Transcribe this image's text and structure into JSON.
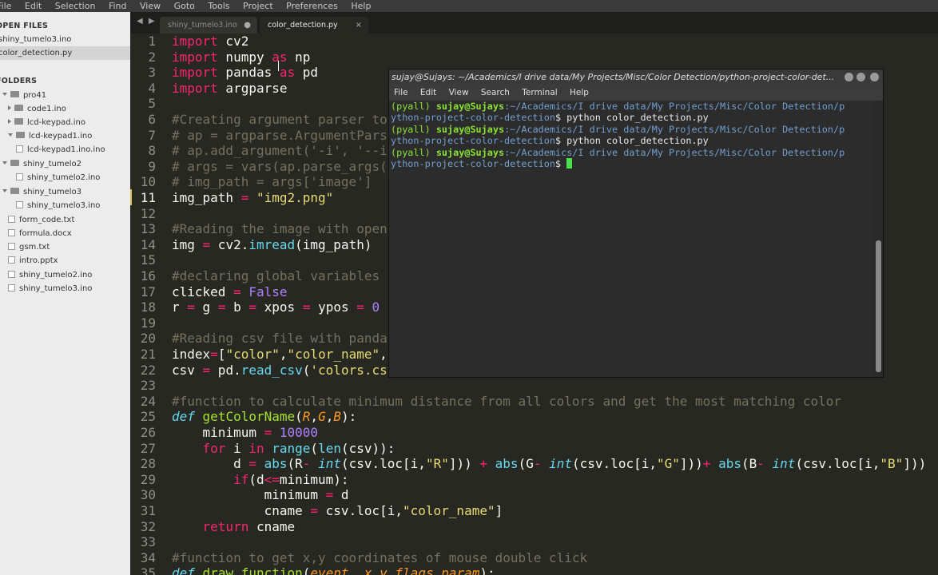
{
  "menubar": {
    "items": [
      "File",
      "Edit",
      "Selection",
      "Find",
      "View",
      "Goto",
      "Tools",
      "Project",
      "Preferences",
      "Help"
    ]
  },
  "sidebar": {
    "open_files_heading": "OPEN FILES",
    "open_files": [
      "shiny_tumelo3.ino",
      "color_detection.py"
    ],
    "folders_heading": "FOLDERS",
    "tree": [
      {
        "label": "pro41",
        "kind": "folder-open"
      },
      {
        "label": "code1.ino",
        "kind": "folder"
      },
      {
        "label": "lcd-keypad.ino",
        "kind": "folder"
      },
      {
        "label": "lcd-keypad1.ino",
        "kind": "folder-open"
      },
      {
        "label": "lcd-keypad1.ino.ino",
        "kind": "file"
      },
      {
        "label": "shiny_tumelo2",
        "kind": "folder-open"
      },
      {
        "label": "shiny_tumelo2.ino",
        "kind": "file"
      },
      {
        "label": "shiny_tumelo3",
        "kind": "folder-open"
      },
      {
        "label": "shiny_tumelo3.ino",
        "kind": "file"
      },
      {
        "label": "form_code.txt",
        "kind": "file"
      },
      {
        "label": "formula.docx",
        "kind": "file"
      },
      {
        "label": "gsm.txt",
        "kind": "file"
      },
      {
        "label": "intro.pptx",
        "kind": "file"
      },
      {
        "label": "shiny_tumelo2.ino",
        "kind": "file"
      },
      {
        "label": "shiny_tumelo3.ino",
        "kind": "file"
      }
    ]
  },
  "tabs": {
    "nav": "◀ ▶",
    "tab1": {
      "label": "shiny_tumelo3.ino",
      "mark": "●"
    },
    "tab2": {
      "label": "color_detection.py",
      "mark": "×"
    }
  },
  "editor": {
    "line_numbers": [
      "1",
      "2",
      "3",
      "4",
      "5",
      "6",
      "7",
      "8",
      "9",
      "10",
      "11",
      "12",
      "13",
      "14",
      "15",
      "16",
      "17",
      "18",
      "19",
      "20",
      "21",
      "22",
      "23",
      "24",
      "25",
      "26",
      "27",
      "28",
      "29",
      "30",
      "31",
      "32",
      "33",
      "34",
      "35"
    ],
    "current_line": "11",
    "code": {
      "l1": "import cv2",
      "l2": "import numpy as np",
      "l3": "import pandas as pd",
      "l4": "import argparse",
      "l6": "#Creating argument parser to",
      "l7": "# ap = argparse.ArgumentParse",
      "l8": "# ap.add_argument('-i', '--i",
      "l9": "# args = vars(ap.parse_args(",
      "l10": "# img_path = args['image']",
      "l11": "img_path = \"img2.png\"",
      "l13": "#Reading the image with opencv",
      "l14": "img = cv2.imread(img_path)",
      "l16": "#declaring global variables (are used later on)",
      "l17": "clicked = False",
      "l18": "r = g = b = xpos = ypos = 0",
      "l20": "#Reading csv file with pandas and giving names to each column",
      "l21": "index=[\"color\",\"color_name\",\"hex\",\"R\",\"G\",\"B\"]",
      "l22": "csv = pd.read_csv('colors.csv', names=index, header=None)",
      "l24": "#function to calculate minimum distance from all colors and get the most matching color",
      "l25": "def getColorName(R,G,B):",
      "l26": "    minimum = 10000",
      "l27": "    for i in range(len(csv)):",
      "l28": "        d = abs(R- int(csv.loc[i,\"R\"])) + abs(G- int(csv.loc[i,\"G\"]))+ abs(B- int(csv.loc[i,\"B\"]))",
      "l29": "        if(d<=minimum):",
      "l30": "            minimum = d",
      "l31": "            cname = csv.loc[i,\"color_name\"]",
      "l32": "    return cname",
      "l34": "#function to get x,y coordinates of mouse double click",
      "l35": "def draw_function(event, x,y,flags,param):"
    }
  },
  "terminal": {
    "title": "sujay@Sujays: ~/Academics/I drive data/My Projects/Misc/Color Detection/python-project-color-det...",
    "menu": [
      "File",
      "Edit",
      "View",
      "Search",
      "Terminal",
      "Help"
    ],
    "env": "(pyall)",
    "user_host": "sujay@Sujays",
    "path_part1": ":~/Academics/I drive data/My Projects/Misc/Color Detection/p",
    "path_part2": "ython-project-color-detection",
    "prompt_suffix": "$",
    "command": " python color_detection.py"
  },
  "colors": {
    "editor_bg": "#272822",
    "keyword": "#f92672",
    "function": "#66d9ef",
    "string": "#e6db74",
    "number": "#ae81ff",
    "comment": "#75715e",
    "terminal_green": "#8ae234",
    "terminal_blue": "#729fcf"
  }
}
